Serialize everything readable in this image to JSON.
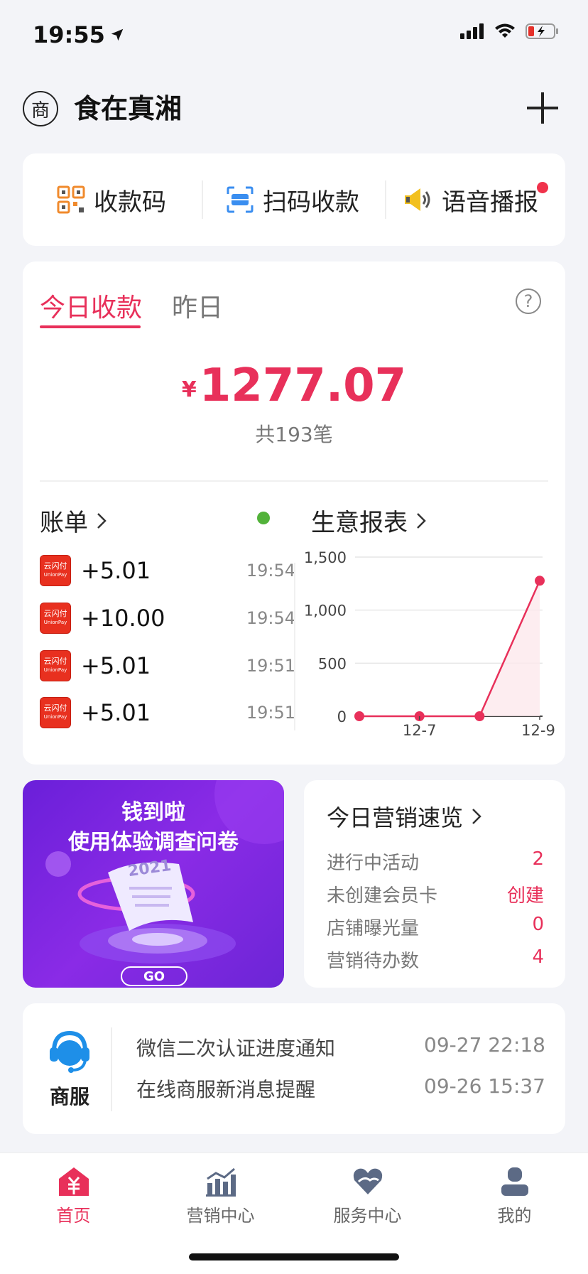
{
  "status_bar": {
    "time": "19:55"
  },
  "header": {
    "shop_badge": "商",
    "shop_name": "食在真湘"
  },
  "quick_actions": [
    {
      "label": "收款码",
      "icon": "qr-code-icon"
    },
    {
      "label": "扫码收款",
      "icon": "scan-icon"
    },
    {
      "label": "语音播报",
      "icon": "speaker-icon"
    }
  ],
  "income": {
    "tabs": [
      "今日收款",
      "昨日"
    ],
    "currency": "¥",
    "amount": "1277.07",
    "count": "共193笔",
    "bill_title": "账单",
    "report_title": "生意报表",
    "bills": [
      {
        "amount": "+5.01",
        "time": "19:54"
      },
      {
        "amount": "+10.00",
        "time": "19:54"
      },
      {
        "amount": "+5.01",
        "time": "19:51"
      },
      {
        "amount": "+5.01",
        "time": "19:51"
      }
    ],
    "logo_text": "云闪付",
    "logo_sub": "UnionPay"
  },
  "chart_data": {
    "type": "line",
    "x": [
      "",
      "12-7",
      "",
      "12-9"
    ],
    "values": [
      0,
      0,
      0,
      1277.07
    ],
    "ylim": [
      0,
      1500
    ],
    "yticks": [
      "0",
      "500",
      "1,000",
      "1,500"
    ],
    "xticks": [
      "12-7",
      "12-9"
    ],
    "grid": true,
    "color": "#e8305a"
  },
  "promo": {
    "line1": "钱到啦",
    "line2": "使用体验调查问卷",
    "year": "2021",
    "go": "GO"
  },
  "marketing": {
    "title": "今日营销速览",
    "rows": [
      {
        "label": "进行中活动",
        "value": "2"
      },
      {
        "label": "未创建会员卡",
        "value": "创建"
      },
      {
        "label": "店铺曝光量",
        "value": "0"
      },
      {
        "label": "营销待办数",
        "value": "4"
      }
    ]
  },
  "service": {
    "label": "商服",
    "messages": [
      {
        "text": "微信二次认证进度通知",
        "time": "09-27 22:18"
      },
      {
        "text": "在线商服新消息提醒",
        "time": "09-26 15:37"
      }
    ]
  },
  "tabbar": [
    {
      "label": "首页",
      "icon": "home-icon",
      "active": true
    },
    {
      "label": "营销中心",
      "icon": "marketing-icon",
      "active": false
    },
    {
      "label": "服务中心",
      "icon": "service-icon",
      "active": false
    },
    {
      "label": "我的",
      "icon": "profile-icon",
      "active": false
    }
  ],
  "colors": {
    "accent": "#e8305a",
    "online": "#52b23a",
    "promo_bg": "#7a27df"
  }
}
